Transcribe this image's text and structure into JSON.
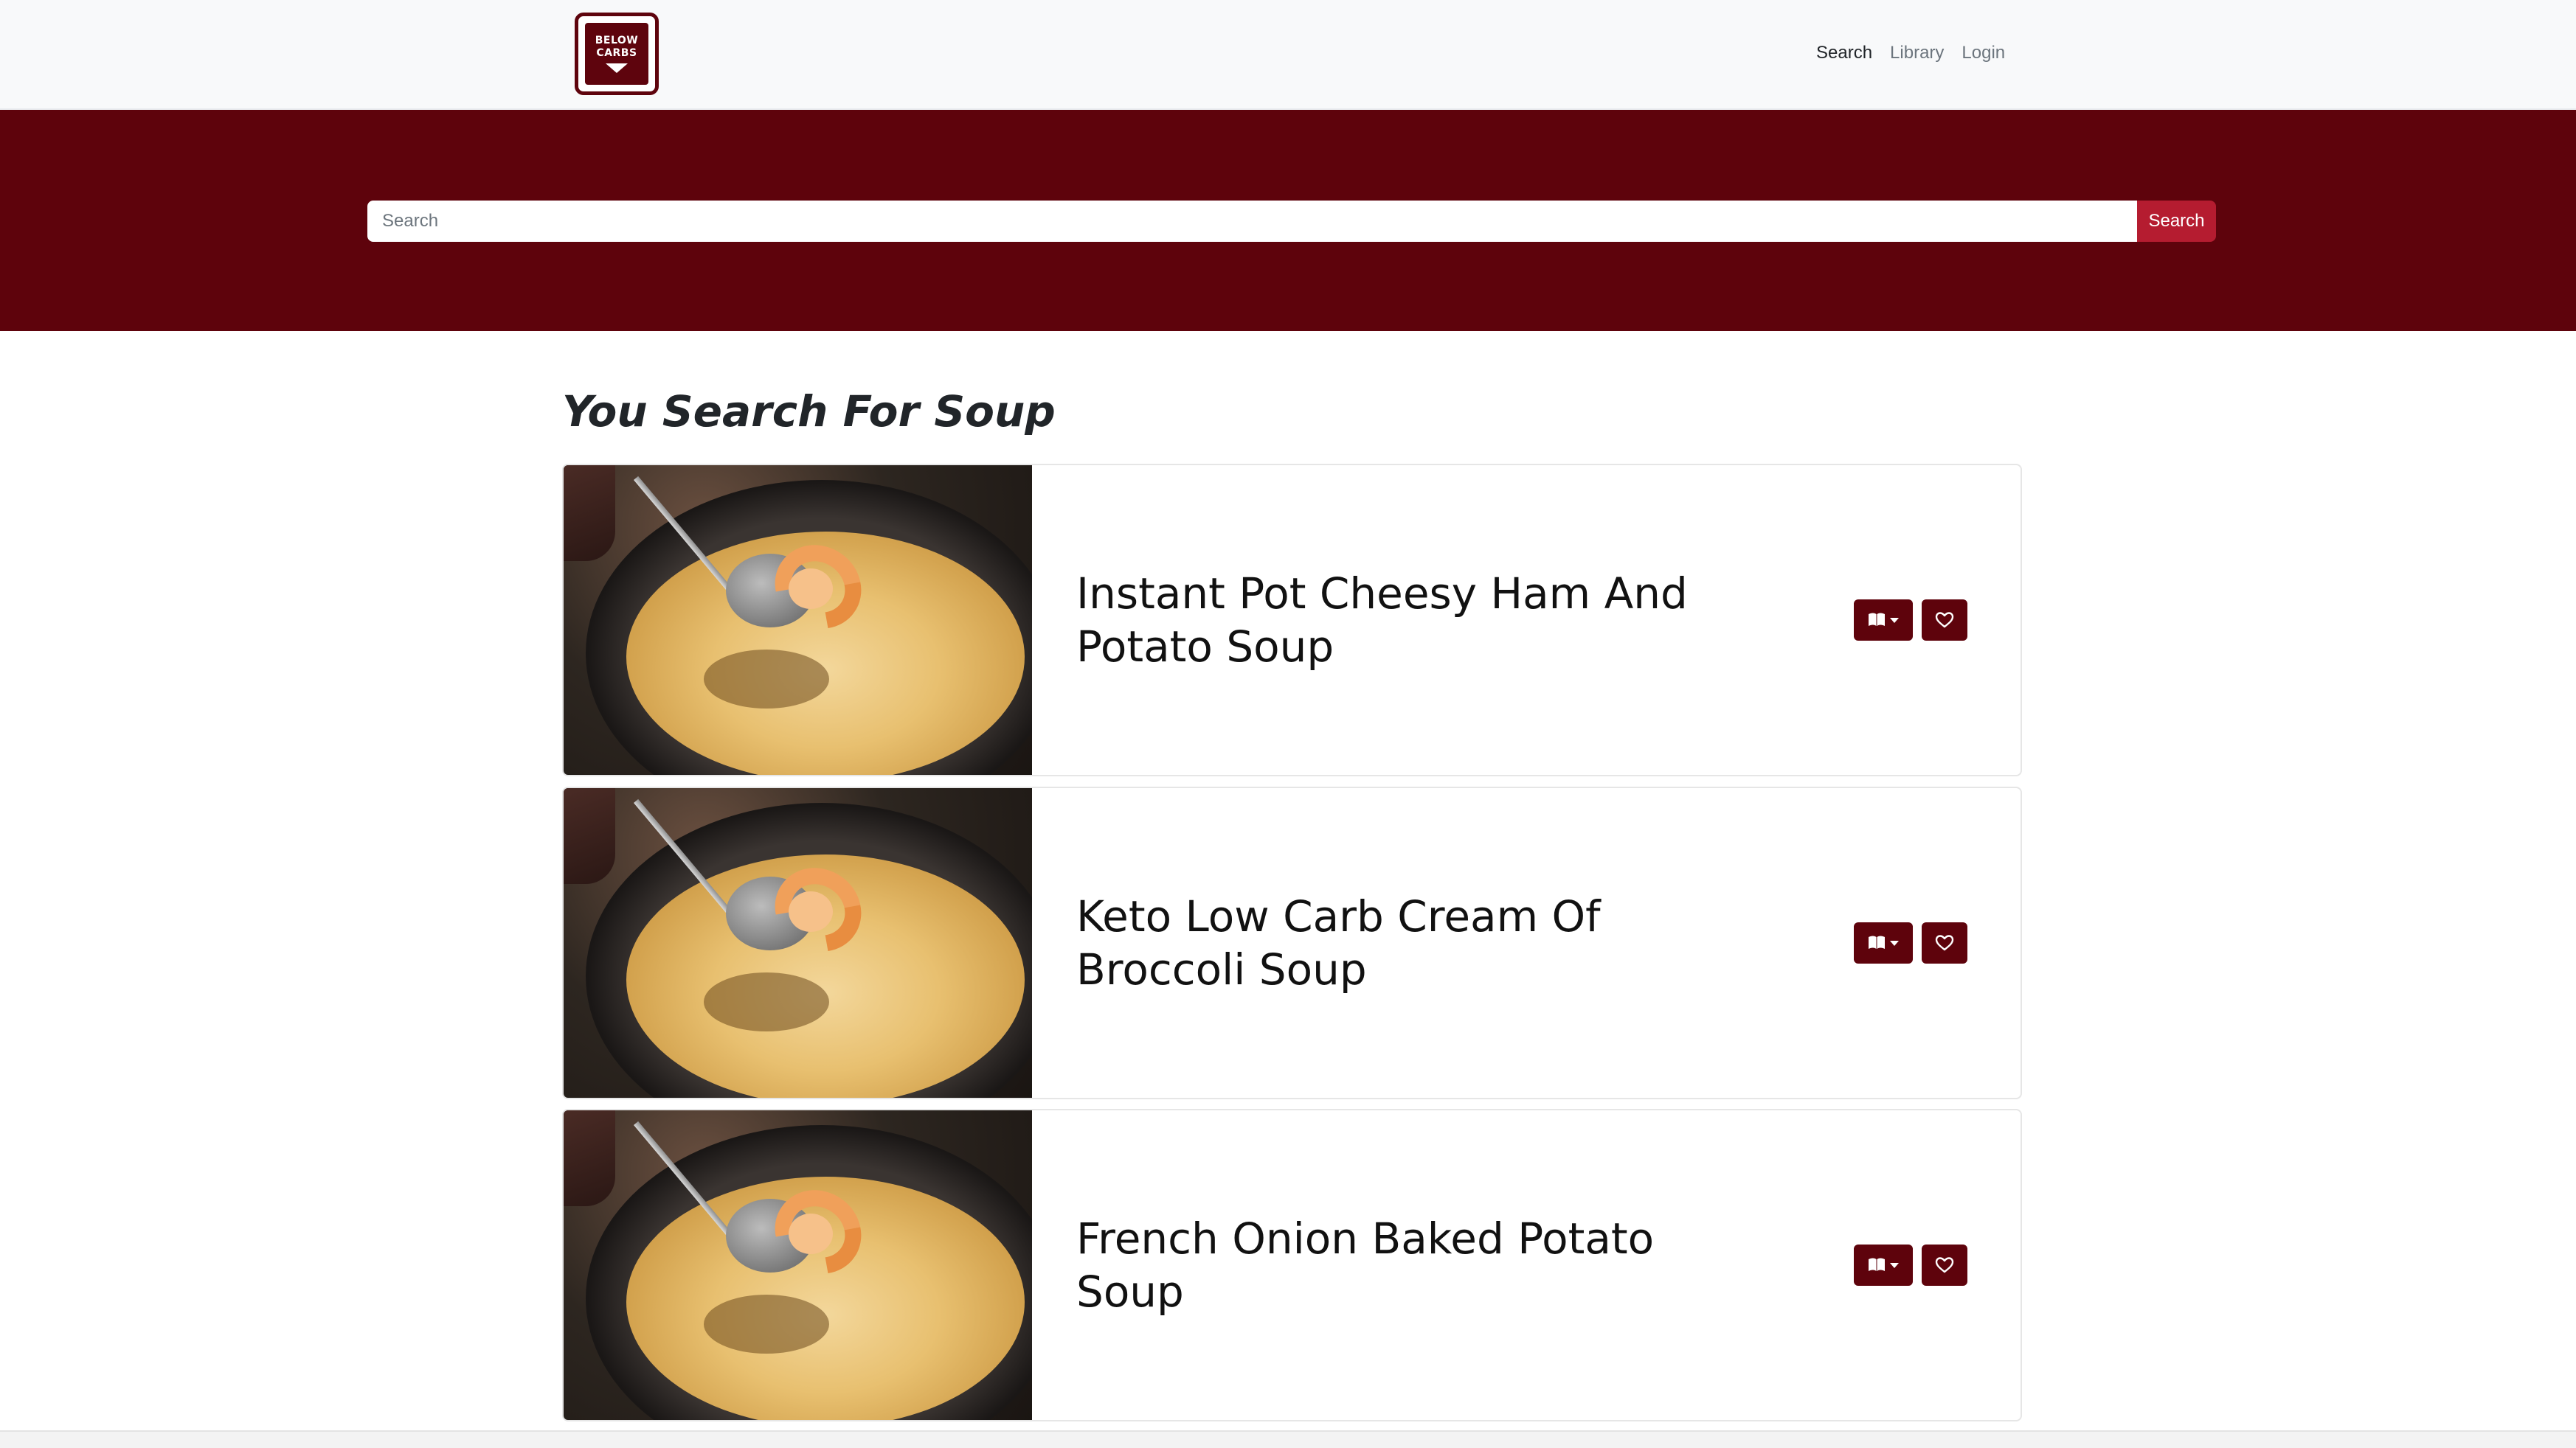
{
  "navbar": {
    "logo_text_line1": "BELOW",
    "logo_text_line2": "CARBS",
    "links": [
      {
        "label": "Search",
        "active": true
      },
      {
        "label": "Library",
        "active": false
      },
      {
        "label": "Login",
        "active": false
      }
    ]
  },
  "search": {
    "placeholder": "Search",
    "value": "",
    "button_label": "Search"
  },
  "results": {
    "heading": "You Search For Soup",
    "recipes": [
      {
        "title": "Instant Pot Cheesy Ham And Potato Soup",
        "library_icon": "book-icon",
        "favorite_icon": "heart-icon"
      },
      {
        "title": "Keto Low Carb Cream Of Broccoli Soup",
        "library_icon": "book-icon",
        "favorite_icon": "heart-icon"
      },
      {
        "title": "French Onion Baked Potato Soup",
        "library_icon": "book-icon",
        "favorite_icon": "heart-icon"
      }
    ]
  },
  "colors": {
    "brand_dark": "#5e030c",
    "search_button": "#b51c30",
    "navbar_bg": "#f8f9fa"
  }
}
